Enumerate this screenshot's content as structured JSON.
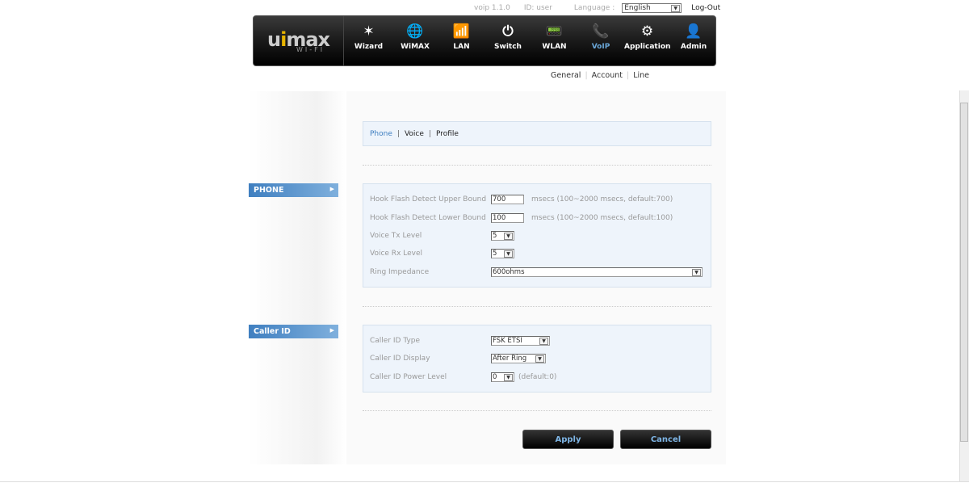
{
  "header": {
    "version": "voip 1.1.0",
    "user_id": "ID: user",
    "language_label": "Language :",
    "language_value": "English",
    "logout": "Log-Out"
  },
  "logo": {
    "text_a": "u",
    "text_b": "i",
    "text_c": "max",
    "sub": "WI-FI"
  },
  "nav": [
    {
      "label": "Wizard",
      "icon": "wand-icon",
      "glyph": "✶"
    },
    {
      "label": "WiMAX",
      "icon": "globe-icon",
      "glyph": "🌐"
    },
    {
      "label": "LAN",
      "icon": "signal-icon",
      "glyph": "📶"
    },
    {
      "label": "Switch",
      "icon": "power-icon",
      "glyph": "⏻"
    },
    {
      "label": "WLAN",
      "icon": "router-icon",
      "glyph": "📟"
    },
    {
      "label": "VoIP",
      "icon": "phone-icon",
      "glyph": "📞",
      "active": true
    },
    {
      "label": "Application",
      "icon": "app-gear-icon",
      "glyph": "⚙"
    },
    {
      "label": "Admin",
      "icon": "user-icon",
      "glyph": "👤"
    }
  ],
  "subnav": [
    "General",
    "Account",
    "Line"
  ],
  "sidebar": {
    "phone": "PHONE",
    "caller_id": "Caller ID"
  },
  "tabs": [
    "Phone",
    "Voice",
    "Profile"
  ],
  "phone": {
    "upper_label": "Hook Flash Detect Upper Bound",
    "upper_value": "700",
    "upper_hint": "msecs (100~2000 msecs, default:700)",
    "lower_label": "Hook Flash Detect Lower Bound",
    "lower_value": "100",
    "lower_hint": "msecs (100~2000 msecs, default:100)",
    "tx_label": "Voice Tx Level",
    "tx_value": "5",
    "rx_label": "Voice Rx Level",
    "rx_value": "5",
    "ring_label": "Ring Impedance",
    "ring_value": "600ohms"
  },
  "caller": {
    "type_label": "Caller ID Type",
    "type_value": "FSK ETSI",
    "display_label": "Caller ID Display",
    "display_value": "After Ring",
    "power_label": "Caller ID Power Level",
    "power_value": "0",
    "power_hint": "(default:0)"
  },
  "buttons": {
    "apply": "Apply",
    "cancel": "Cancel"
  },
  "colors": {
    "accent": "#3d7ec0",
    "nav_bg": "#1a1a1a",
    "panel_bg": "#eef4fb"
  }
}
